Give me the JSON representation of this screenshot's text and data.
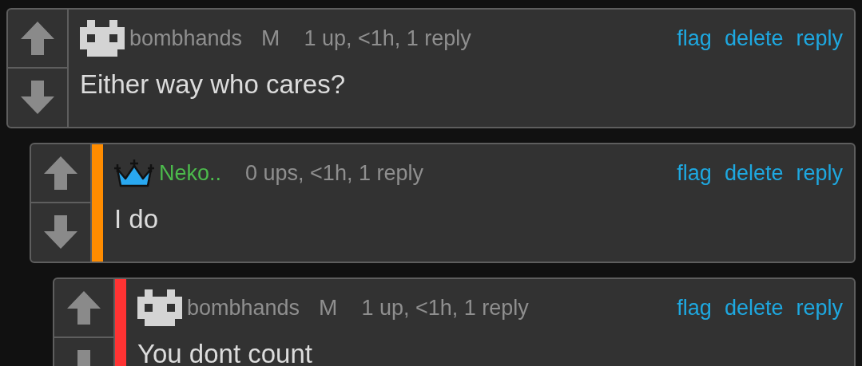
{
  "comments": [
    {
      "avatar": {
        "kind": "pixel"
      },
      "username": "bombhands",
      "badge": "M",
      "meta": "1 up, <1h, 1 reply",
      "actions": [
        "flag",
        "delete",
        "reply"
      ],
      "body": "Either way who cares?"
    },
    {
      "avatar": {
        "kind": "crown"
      },
      "username": "Neko..",
      "meta": "0 ups, <1h, 1 reply",
      "actions": [
        "flag",
        "delete",
        "reply"
      ],
      "body": "I do",
      "color": "#ff8c00"
    },
    {
      "avatar": {
        "kind": "pixel"
      },
      "username": "bombhands",
      "badge": "M",
      "meta": "1 up, <1h, 1 reply",
      "actions": [
        "flag",
        "delete",
        "reply"
      ],
      "body": "You dont count",
      "color": "#ff3333"
    }
  ]
}
